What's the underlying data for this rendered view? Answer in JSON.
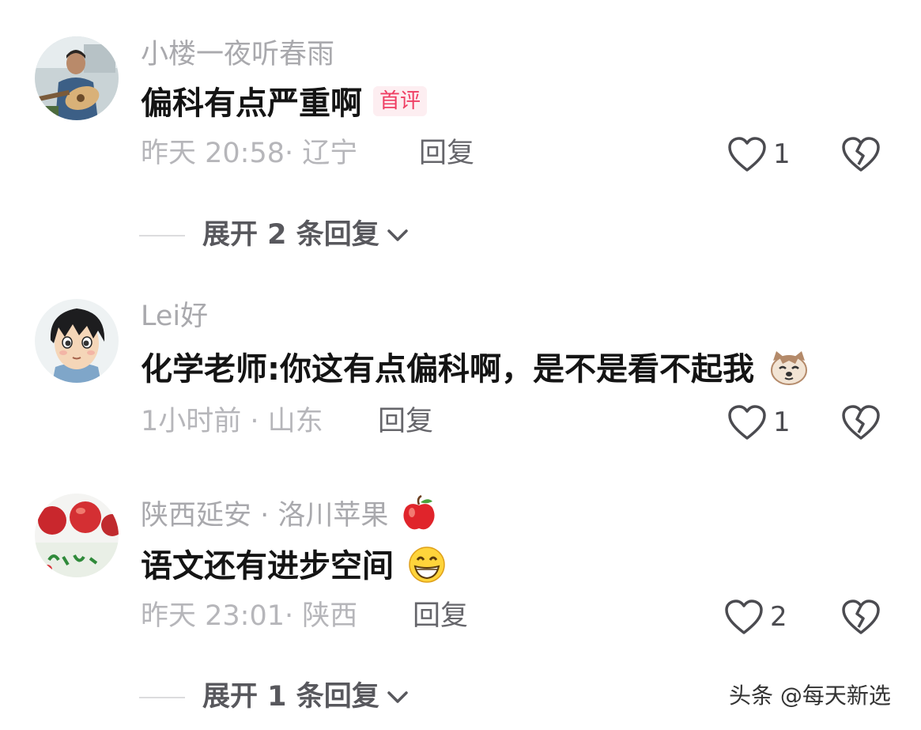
{
  "comments": [
    {
      "username": "小楼一夜听春雨",
      "text": "偏科有点严重啊",
      "badge": "首评",
      "meta": "昨天 20:58· 辽宁",
      "reply_label": "回复",
      "likes": "1",
      "expand_label": "展开 2 条回复"
    },
    {
      "username": "Lei好",
      "text": "化学老师:你这有点偏科啊，是不是看不起我",
      "emoji": "cat-face-emoji",
      "meta": "1小时前 · 山东",
      "reply_label": "回复",
      "likes": "1"
    },
    {
      "username": "陕西延安 · 洛川苹果",
      "username_emoji": "red-apple-emoji",
      "text": "语文还有进步空间",
      "emoji": "grinning-face-emoji",
      "meta": "昨天 23:01· 陕西",
      "reply_label": "回复",
      "likes": "2",
      "expand_label": "展开 1 条回复"
    }
  ],
  "watermark": "头条 @每天新选",
  "colors": {
    "username": "#a9a9ad",
    "comment_text": "#141414",
    "meta": "#b6b6ba",
    "badge": "#ef3e63",
    "badge_bg": "#fdeef1"
  }
}
